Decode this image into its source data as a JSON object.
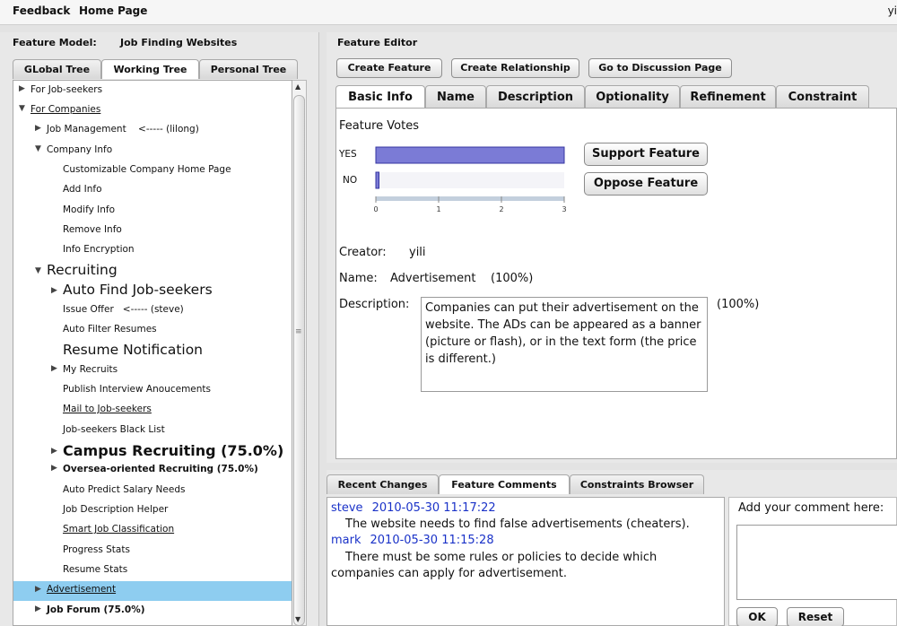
{
  "topbar": {
    "feedback": "Feedback",
    "home": "Home Page",
    "user": "yi"
  },
  "left": {
    "label": "Feature Model:",
    "model_name": "Job Finding Websites",
    "tabs": [
      "GLobal Tree",
      "Working Tree",
      "Personal Tree"
    ],
    "active_tab": "Working Tree",
    "tree": [
      {
        "text": "For Job-seekers",
        "toggle": "▶"
      },
      {
        "text": "For Companies",
        "toggle": "▼"
      },
      {
        "text": "Job Management    <----- (lilong)",
        "toggle": "▶"
      },
      {
        "text": "Company Info",
        "toggle": "▼"
      },
      {
        "text": "Customizable Company Home Page",
        "toggle": ""
      },
      {
        "text": "Add Info",
        "toggle": ""
      },
      {
        "text": "Modify Info",
        "toggle": ""
      },
      {
        "text": "Remove Info",
        "toggle": ""
      },
      {
        "text": "Info Encryption",
        "toggle": ""
      },
      {
        "text": "Recruiting",
        "toggle": "▼"
      },
      {
        "text": "Auto Find Job-seekers",
        "toggle": "▶"
      },
      {
        "text": "Issue Offer   <----- (steve)",
        "toggle": ""
      },
      {
        "text": "Auto Filter Resumes",
        "toggle": ""
      },
      {
        "text": "Resume Notification",
        "toggle": ""
      },
      {
        "text": "My Recruits",
        "toggle": "▶"
      },
      {
        "text": "Publish Interview Anoucements",
        "toggle": ""
      },
      {
        "text": "Mail to Job-seekers",
        "toggle": ""
      },
      {
        "text": "Job-seekers Black List",
        "toggle": ""
      },
      {
        "text": "Campus Recruiting (75.0%)",
        "toggle": "▶"
      },
      {
        "text": "Oversea-oriented Recruiting (75.0%)",
        "toggle": "▶"
      },
      {
        "text": "Auto Predict Salary Needs",
        "toggle": ""
      },
      {
        "text": "Job Description Helper",
        "toggle": ""
      },
      {
        "text": "Smart Job Classification",
        "toggle": ""
      },
      {
        "text": "Progress Stats",
        "toggle": ""
      },
      {
        "text": "Resume Stats",
        "toggle": ""
      },
      {
        "text": "Advertisement",
        "toggle": "▶"
      },
      {
        "text": "Job Forum (75.0%)",
        "toggle": "▶"
      }
    ],
    "selected_item": "Advertisement"
  },
  "editor": {
    "title": "Feature Editor",
    "action_buttons": [
      "Create Feature",
      "Create Relationship",
      "Go to Discussion Page"
    ],
    "tabs": [
      "Basic Info",
      "Name",
      "Description",
      "Optionality",
      "Refinement",
      "Constraint"
    ],
    "active_tab": "Basic Info",
    "votes_title": "Feature Votes",
    "votes": [
      {
        "label": "YES",
        "value": 3
      },
      {
        "label": "NO",
        "value": 0.05
      }
    ],
    "vote_axis": {
      "min": 0,
      "max": 3,
      "ticks": [
        "0",
        "1",
        "2",
        "3"
      ]
    },
    "support_button": "Support Feature",
    "oppose_button": "Oppose Feature",
    "creator_label": "Creator:",
    "creator": "yili",
    "name_label": "Name:",
    "name_value": "Advertisement",
    "name_pct": "(100%)",
    "description_label": "Description:",
    "description": "Companies can put their advertisement on the website. The ADs can be appeared as a banner (picture or flash), or in the text form (the price is different.)",
    "description_pct": "(100%)",
    "bar_color": "#7b7bd6"
  },
  "bottom": {
    "tabs": [
      "Recent Changes",
      "Feature Comments",
      "Constraints Browser"
    ],
    "active_tab": "Feature Comments",
    "comments": [
      {
        "author": "steve",
        "date": "2010-05-30 11:17:22",
        "text": "The website needs to find false advertisements (cheaters)."
      },
      {
        "author": "mark",
        "date": "2010-05-30 11:15:28",
        "text": "There must be some rules or policies to decide which companies can apply for advertisement."
      }
    ],
    "add_label": "Add your comment here:",
    "ok": "OK",
    "reset": "Reset"
  }
}
